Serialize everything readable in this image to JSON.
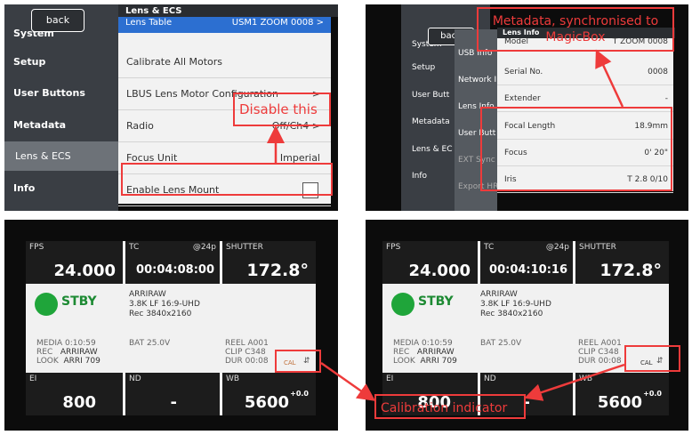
{
  "lens_menu": {
    "back": "back",
    "sidebar": [
      "System",
      "Setup",
      "User Buttons",
      "Metadata",
      "Lens & ECS",
      "Info"
    ],
    "header": "Lens & ECS",
    "first_row": "Lens Table",
    "first_row_value": "USM1 ZOOM 0008 >",
    "rows": [
      {
        "label": "Calibrate All Motors",
        "value": ""
      },
      {
        "label": "LBUS Lens Motor Configuration",
        "value": ">"
      },
      {
        "label": "Radio",
        "value": "Off/Ch4 >"
      },
      {
        "label": "Focus Unit",
        "value": "Imperial"
      },
      {
        "label": "Enable Lens Mount",
        "value": ""
      }
    ],
    "annotation": "Disable this"
  },
  "lens_info": {
    "back": "back",
    "sidebar": [
      "System",
      "Setup",
      "User Butt",
      "Metadata",
      "Lens & EC",
      "Info"
    ],
    "submenu": [
      "USB Info",
      "Network I",
      "Lens Info",
      "User Butt",
      "EXT Sync",
      "Export HR"
    ],
    "header": "Lens Info",
    "rows": [
      {
        "label": "Model",
        "value": "T ZOOM 0008"
      },
      {
        "label": "Serial No.",
        "value": "0008"
      },
      {
        "label": "Extender",
        "value": "-"
      },
      {
        "label": "Focal Length",
        "value": "18.9mm"
      },
      {
        "label": "Focus",
        "value": "0' 20\""
      },
      {
        "label": "Iris",
        "value": "T 2.8   0/10"
      }
    ],
    "annotation": "Metadata, synchronised to MagicBox"
  },
  "home_left": {
    "fps_label": "FPS",
    "fps": "24.000",
    "tc_label": "TC",
    "tc_rate": "@24p",
    "tc": "00:04:08:00",
    "shutter_label": "SHUTTER",
    "shutter": "172.8°",
    "status": "STBY",
    "format": [
      "ARRIRAW",
      "3.8K LF 16:9-UHD",
      "Rec 3840x2160"
    ],
    "media": "MEDIA 0:10:59",
    "rec": "REC",
    "rec_val": "ARRIRAW",
    "look": "LOOK",
    "look_val": "ARRI 709",
    "bat": "BAT 25.0V",
    "reel": "REEL A001",
    "clip": "CLIP C348",
    "dur": "DUR 00:08",
    "cal": "CAL",
    "ei_label": "EI",
    "ei": "800",
    "nd_label": "ND",
    "nd": "-",
    "wb_label": "WB",
    "wb": "5600",
    "wb_tint": "+0.0"
  },
  "home_right": {
    "fps_label": "FPS",
    "fps": "24.000",
    "tc_label": "TC",
    "tc_rate": "@24p",
    "tc": "00:04:10:16",
    "shutter_label": "SHUTTER",
    "shutter": "172.8°",
    "status": "STBY",
    "format": [
      "ARRIRAW",
      "3.8K LF 16:9-UHD",
      "Rec 3840x2160"
    ],
    "media": "MEDIA 0:10:59",
    "rec": "REC",
    "rec_val": "ARRIRAW",
    "look": "LOOK",
    "look_val": "ARRI 709",
    "bat": "BAT 25.0V",
    "reel": "REEL A001",
    "clip": "CLIP C348",
    "dur": "DUR 00:08",
    "cal": "CAL",
    "ei_label": "EI",
    "ei": "800",
    "nd_label": "ND",
    "nd": "-",
    "wb_label": "WB",
    "wb": "5600",
    "wb_tint": "+0.0"
  },
  "calibration_annotation": "Calibration indicator",
  "colors": {
    "annotation": "#ee3b3b",
    "highlight": "#2c6fd1",
    "status": "#1fa53a"
  }
}
